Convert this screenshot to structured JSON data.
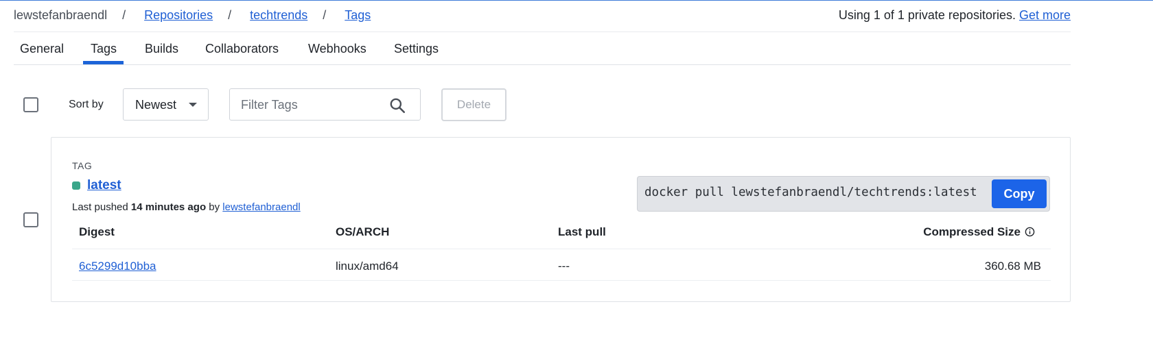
{
  "breadcrumb": {
    "owner": "lewstefanbraendl",
    "separator": "/",
    "repositories": "Repositories",
    "repo": "techtrends",
    "tags": "Tags"
  },
  "usage": {
    "text": "Using 1 of 1 private repositories.",
    "link": "Get more"
  },
  "tabs": [
    {
      "label": "General",
      "active": false
    },
    {
      "label": "Tags",
      "active": true
    },
    {
      "label": "Builds",
      "active": false
    },
    {
      "label": "Collaborators",
      "active": false
    },
    {
      "label": "Webhooks",
      "active": false
    },
    {
      "label": "Settings",
      "active": false
    }
  ],
  "toolbar": {
    "sort_label": "Sort by",
    "sort_value": "Newest",
    "filter_placeholder": "Filter Tags",
    "delete_label": "Delete"
  },
  "tag": {
    "header": "TAG",
    "name": "latest",
    "status_color": "#3aa68a",
    "pushed_prefix": "Last pushed",
    "pushed_when": "14 minutes ago",
    "pushed_by_word": "by",
    "pushed_by": "lewstefanbraendl",
    "pull_command": "docker pull lewstefanbraendl/techtrends:latest",
    "copy_label": "Copy"
  },
  "table": {
    "columns": [
      "Digest",
      "OS/ARCH",
      "Last pull",
      "Compressed Size"
    ],
    "rows": [
      {
        "digest": "6c5299d10bba",
        "os_arch": "linux/amd64",
        "last_pull": "---",
        "size": "360.68 MB"
      }
    ]
  },
  "colors": {
    "accent": "#1c64e8",
    "link": "#1f5fd4"
  }
}
